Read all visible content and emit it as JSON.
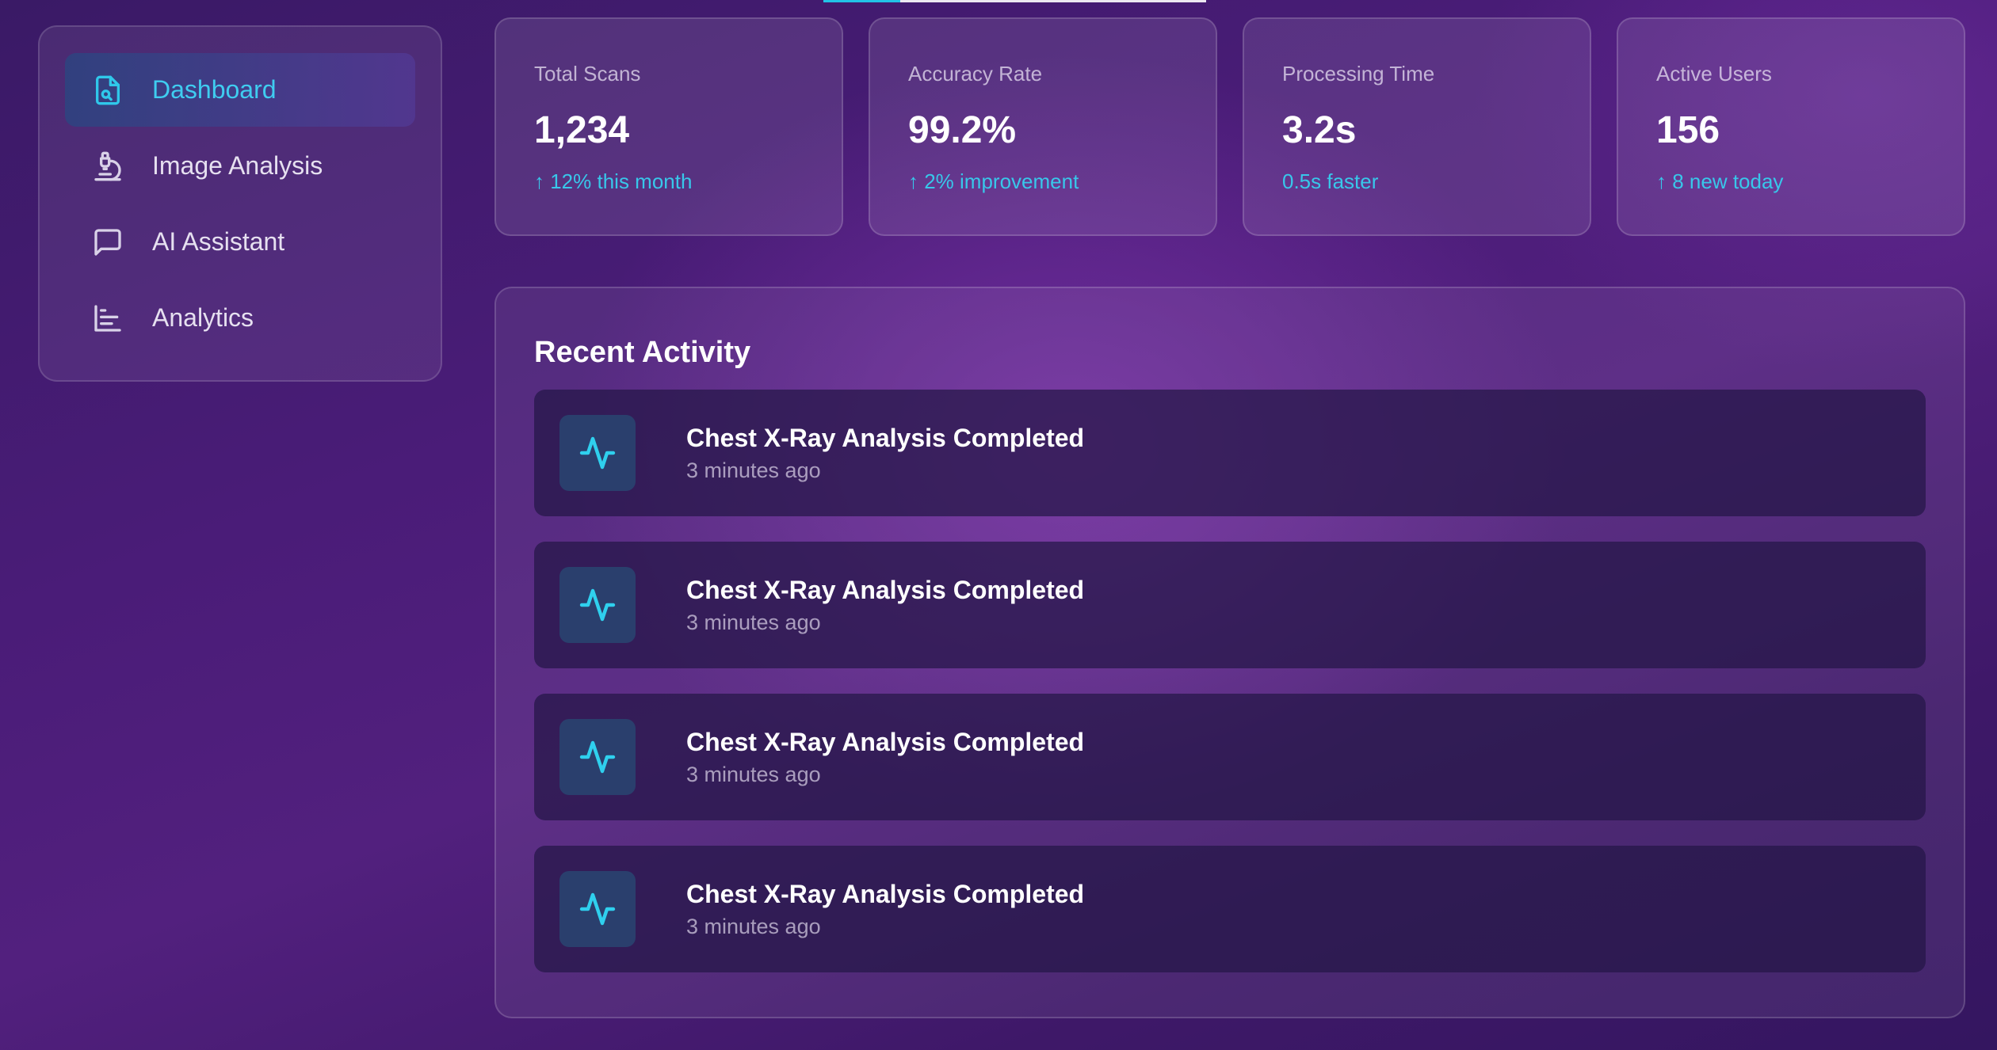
{
  "top_progress": {
    "fill_fraction": 0.2
  },
  "sidebar": {
    "items": [
      {
        "label": "Dashboard",
        "icon": "file-search-icon",
        "active": true
      },
      {
        "label": "Image Analysis",
        "icon": "microscope-icon",
        "active": false
      },
      {
        "label": "AI Assistant",
        "icon": "message-square-icon",
        "active": false
      },
      {
        "label": "Analytics",
        "icon": "bar-chart-icon",
        "active": false
      }
    ]
  },
  "stats": [
    {
      "label": "Total Scans",
      "value": "1,234",
      "change": "↑ 12% this month"
    },
    {
      "label": "Accuracy Rate",
      "value": "99.2%",
      "change": "↑ 2% improvement"
    },
    {
      "label": "Processing Time",
      "value": "3.2s",
      "change": "0.5s faster"
    },
    {
      "label": "Active Users",
      "value": "156",
      "change": "↑ 8 new today"
    }
  ],
  "activity": {
    "title": "Recent Activity",
    "items": [
      {
        "title": "Chest X-Ray Analysis Completed",
        "time": "3 minutes ago",
        "icon": "activity-pulse-icon"
      },
      {
        "title": "Chest X-Ray Analysis Completed",
        "time": "3 minutes ago",
        "icon": "activity-pulse-icon"
      },
      {
        "title": "Chest X-Ray Analysis Completed",
        "time": "3 minutes ago",
        "icon": "activity-pulse-icon"
      },
      {
        "title": "Chest X-Ray Analysis Completed",
        "time": "3 minutes ago",
        "icon": "activity-pulse-icon"
      }
    ]
  },
  "colors": {
    "accent": "#22c3e6",
    "background": "#4a1c78"
  }
}
